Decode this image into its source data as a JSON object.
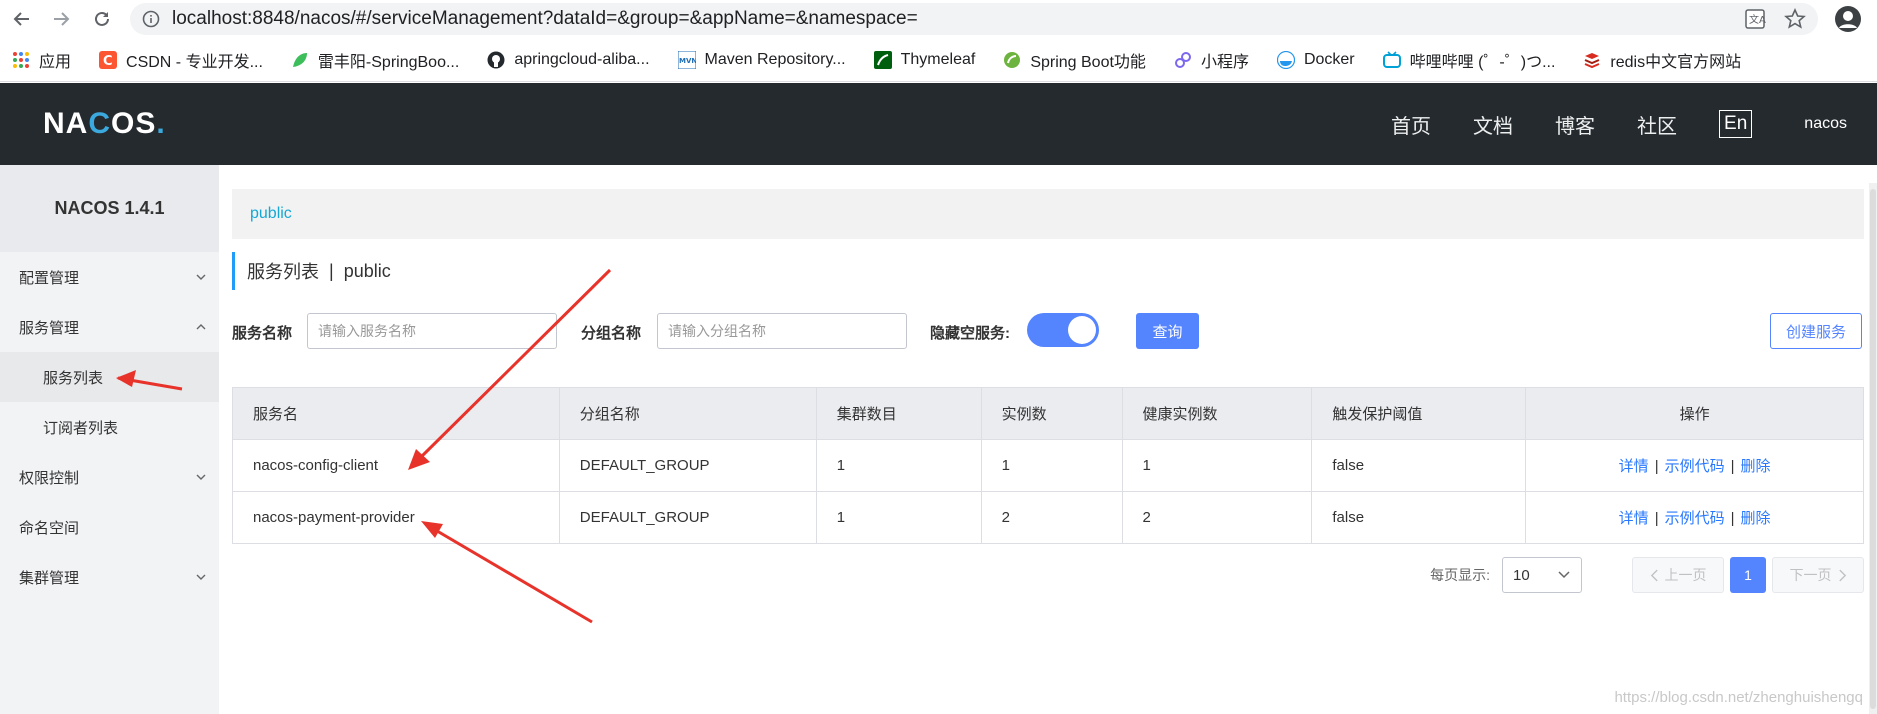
{
  "browser": {
    "url": "localhost:8848/nacos/#/serviceManagement?dataId=&group=&appName=&namespace=",
    "url_host": "localhost",
    "bookmarks": [
      {
        "label": "应用",
        "icon": "apps-grid-icon"
      },
      {
        "label": "CSDN - 专业开发...",
        "icon": "csdn-icon"
      },
      {
        "label": "雷丰阳-SpringBoo...",
        "icon": "leaf-icon"
      },
      {
        "label": "apringcloud-aliba...",
        "icon": "github-icon"
      },
      {
        "label": "Maven Repository...",
        "icon": "mvn-icon"
      },
      {
        "label": "Thymeleaf",
        "icon": "thymeleaf-icon"
      },
      {
        "label": "Spring Boot功能",
        "icon": "spring-icon"
      },
      {
        "label": "小程序",
        "icon": "miniprogram-icon"
      },
      {
        "label": "Docker",
        "icon": "docker-icon"
      },
      {
        "label": "哔哩哔哩 (゜-゜)つ...",
        "icon": "bilibili-icon"
      },
      {
        "label": "redis中文官方网站",
        "icon": "redis-icon"
      }
    ]
  },
  "header": {
    "logo": "NACOS.",
    "logo_parts": [
      "NA",
      "C",
      "OS",
      "."
    ],
    "nav": [
      "首页",
      "文档",
      "博客",
      "社区"
    ],
    "lang": "En",
    "user": "nacos"
  },
  "sidebar": {
    "version": "NACOS 1.4.1",
    "items": [
      {
        "label": "配置管理",
        "expanded": false
      },
      {
        "label": "服务管理",
        "expanded": true
      },
      {
        "label": "服务列表"
      },
      {
        "label": "订阅者列表"
      },
      {
        "label": "权限控制",
        "expanded": false
      },
      {
        "label": "命名空间"
      },
      {
        "label": "集群管理",
        "expanded": false
      }
    ]
  },
  "main": {
    "namespace": "public",
    "title": "服务列表",
    "title_sep": "|",
    "title_ns": "public",
    "filter": {
      "service_label": "服务名称",
      "service_placeholder": "请输入服务名称",
      "group_label": "分组名称",
      "group_placeholder": "请输入分组名称",
      "hide_empty_label": "隐藏空服务:",
      "hide_empty_on": true,
      "query": "查询",
      "create": "创建服务"
    },
    "table": {
      "columns": [
        "服务名",
        "分组名称",
        "集群数目",
        "实例数",
        "健康实例数",
        "触发保护阈值",
        "操作"
      ],
      "rows": [
        {
          "name": "nacos-config-client",
          "group": "DEFAULT_GROUP",
          "clusters": "1",
          "instances": "1",
          "healthy": "1",
          "threshold": "false"
        },
        {
          "name": "nacos-payment-provider",
          "group": "DEFAULT_GROUP",
          "clusters": "1",
          "instances": "2",
          "healthy": "2",
          "threshold": "false"
        }
      ],
      "ops": {
        "detail": "详情",
        "sample": "示例代码",
        "delete": "删除",
        "sep": "|"
      }
    },
    "pager": {
      "label": "每页显示:",
      "page_size": "10",
      "prev": "上一页",
      "current": "1",
      "next": "下一页"
    }
  },
  "watermark": "https://blog.csdn.net/zhenghuishengq",
  "colors": {
    "header_bg": "#252a2f",
    "primary": "#5584ff",
    "link": "#2878ff",
    "annotation": "#e8332b"
  }
}
